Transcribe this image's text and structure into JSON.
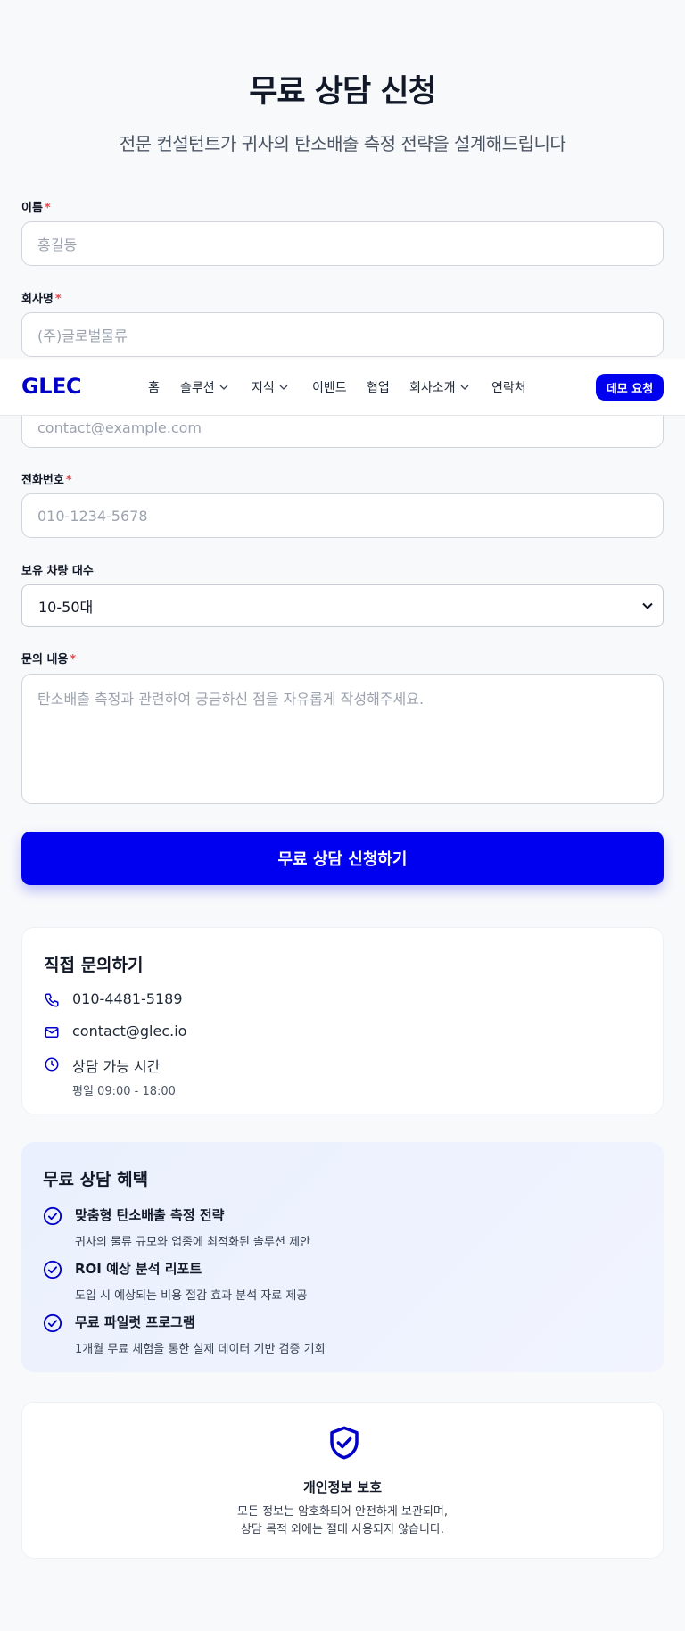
{
  "hero": {
    "title": "무료 상담 신청",
    "subtitle": "전문 컨설턴트가 귀사의 탄소배출 측정 전략을 설계해드립니다"
  },
  "form": {
    "name": {
      "label": "이름",
      "required": "*",
      "placeholder": "홍길동"
    },
    "company": {
      "label": "회사명",
      "required": "*",
      "placeholder": "(주)글로벌물류"
    },
    "email": {
      "placeholder": "contact@example.com"
    },
    "phone": {
      "label": "전화번호",
      "required": "*",
      "placeholder": "010-1234-5678"
    },
    "vehicles": {
      "label": "보유 차량 대수",
      "value": "10-50대"
    },
    "inquiry": {
      "label": "문의 내용",
      "required": "*",
      "placeholder": "탄소배출 측정과 관련하여 궁금하신 점을 자유롭게 작성해주세요."
    },
    "submit_label": "무료 상담 신청하기"
  },
  "navbar": {
    "logo": "GLEC",
    "items": [
      {
        "label": "홈",
        "dropdown": false
      },
      {
        "label": "솔루션",
        "dropdown": true
      },
      {
        "label": "지식",
        "dropdown": true
      },
      {
        "label": "이벤트",
        "dropdown": false
      },
      {
        "label": "협업",
        "dropdown": false
      },
      {
        "label": "회사소개",
        "dropdown": true
      },
      {
        "label": "연락처",
        "dropdown": false
      }
    ],
    "demo_label": "데모 요청"
  },
  "contact": {
    "title": "직접 문의하기",
    "phone": "010-4481-5189",
    "email": "contact@glec.io",
    "hours_label": "상담 가능 시간",
    "hours_value": "평일 09:00 - 18:00"
  },
  "benefits": {
    "title": "무료 상담 혜택",
    "items": [
      {
        "title": "맞춤형 탄소배출 측정 전략",
        "desc": "귀사의 물류 규모와 업종에 최적화된 솔루션 제안"
      },
      {
        "title": "ROI 예상 분석 리포트",
        "desc": "도입 시 예상되는 비용 절감 효과 분석 자료 제공"
      },
      {
        "title": "무료 파일럿 프로그램",
        "desc": "1개월 무료 체험을 통한 실제 데이터 기반 검증 기회"
      }
    ]
  },
  "privacy": {
    "title": "개인정보 보호",
    "line1": "모든 정보는 암호화되어 안전하게 보관되며,",
    "line2": "상담 목적 외에는 절대 사용되지 않습니다."
  },
  "colors": {
    "primary": "#0000f0",
    "logo": "#0000c8",
    "required": "#ef4444",
    "page_bg": "#f8f9fb"
  }
}
